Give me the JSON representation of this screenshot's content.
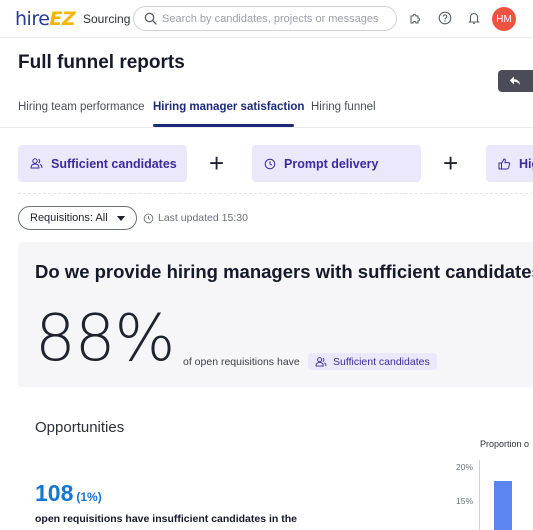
{
  "nav": {
    "logo_part1": "hire",
    "logo_part2": "EZ",
    "sourcing": "Sourcing",
    "search_placeholder": "Search by candidates, projects or messages",
    "avatar_initials": "HM"
  },
  "header": {
    "title": "Full funnel reports"
  },
  "tabs": [
    {
      "label": "Hiring team performance",
      "active": false
    },
    {
      "label": "Hiring manager satisfaction",
      "active": true
    },
    {
      "label": "Hiring funnel",
      "active": false
    }
  ],
  "chips": [
    {
      "label": "Sufficient candidates",
      "icon": "people-icon"
    },
    {
      "label": "Prompt delivery",
      "icon": "clock-icon"
    },
    {
      "label": "Hig",
      "icon": "thumbs-up-icon"
    }
  ],
  "filters": {
    "requisitions_label": "Requisitions: All",
    "last_updated": "Last updated 15:30"
  },
  "card": {
    "question": "Do we provide hiring managers with sufficient candidates?",
    "percent": "88%",
    "percent_value": 88,
    "desc": "of open requisitions have",
    "tag": "Sufficient candidates"
  },
  "opportunities": {
    "title": "Opportunities",
    "count": "108",
    "share": "(1%)",
    "desc": "open requisitions have insufficient candidates in the"
  },
  "chart_data": {
    "type": "bar",
    "title": "Proportion o",
    "y_ticks": [
      "20%",
      "15%"
    ],
    "ylim": [
      0,
      20
    ],
    "values": [
      18
    ],
    "color": "#5c86f0"
  },
  "colors": {
    "brand_navy": "#1b2a7a",
    "chip_bg": "#ece8fc",
    "chip_text": "#3c2a9e",
    "accent_blue": "#1677d2",
    "avatar_red": "#ee5341"
  }
}
